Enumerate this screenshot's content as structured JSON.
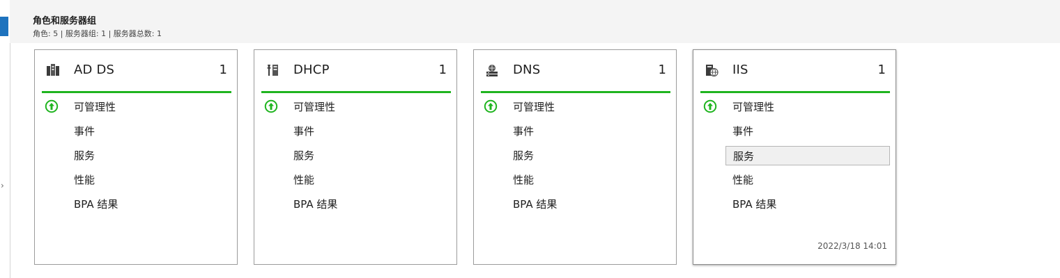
{
  "header": {
    "title": "角色和服务器组",
    "subtitle": "角色: 5 | 服务器组: 1 | 服务器总数: 1"
  },
  "colors": {
    "status_green": "#1fb41f",
    "accent_blue": "#1e73be"
  },
  "tiles": [
    {
      "name": "AD DS",
      "count": "1",
      "icon": "ad-ds-icon",
      "items": [
        "可管理性",
        "事件",
        "服务",
        "性能",
        "BPA 结果"
      ],
      "timestamp": ""
    },
    {
      "name": "DHCP",
      "count": "1",
      "icon": "dhcp-icon",
      "items": [
        "可管理性",
        "事件",
        "服务",
        "性能",
        "BPA 结果"
      ],
      "timestamp": ""
    },
    {
      "name": "DNS",
      "count": "1",
      "icon": "dns-icon",
      "items": [
        "可管理性",
        "事件",
        "服务",
        "性能",
        "BPA 结果"
      ],
      "timestamp": ""
    },
    {
      "name": "IIS",
      "count": "1",
      "icon": "iis-icon",
      "items": [
        "可管理性",
        "事件",
        "服务",
        "性能",
        "BPA 结果"
      ],
      "timestamp": "2022/3/18 14:01"
    }
  ]
}
